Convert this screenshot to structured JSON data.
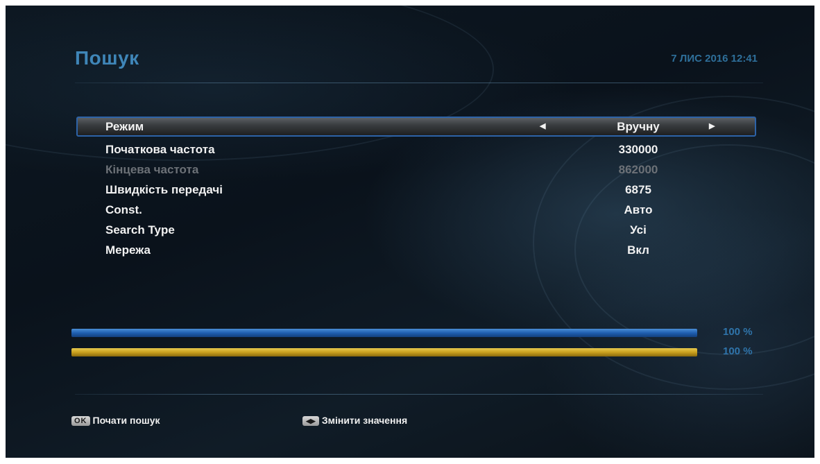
{
  "header": {
    "title": "Пошук",
    "datetime": "7 ЛИС 2016 12:41"
  },
  "menu": {
    "items": [
      {
        "label": "Режим",
        "value": "Вручну",
        "selected": true,
        "disabled": false
      },
      {
        "label": "Початкова частота",
        "value": "330000",
        "selected": false,
        "disabled": false
      },
      {
        "label": "Кінцева частота",
        "value": "862000",
        "selected": false,
        "disabled": true
      },
      {
        "label": "Швидкість передачі",
        "value": "6875",
        "selected": false,
        "disabled": false
      },
      {
        "label": "Const.",
        "value": "Авто",
        "selected": false,
        "disabled": false
      },
      {
        "label": "Search Type",
        "value": "Усі",
        "selected": false,
        "disabled": false
      },
      {
        "label": "Мережа",
        "value": "Вкл",
        "selected": false,
        "disabled": false
      }
    ]
  },
  "signal": {
    "strength_percent": 100,
    "strength_label": "100 %",
    "strength_color": "#1f5fb0",
    "quality_percent": 100,
    "quality_label": "100 %",
    "quality_color": "#c9a01e"
  },
  "footer": {
    "ok_key": "OK",
    "ok_label": "Почати пошук",
    "arrows_key_icon": "left-right-arrows-icon",
    "change_label": "Змінити значення"
  },
  "colors": {
    "title": "#3f86b8",
    "selection_border": "#2d63a8",
    "disabled_text": "#6c7177"
  }
}
